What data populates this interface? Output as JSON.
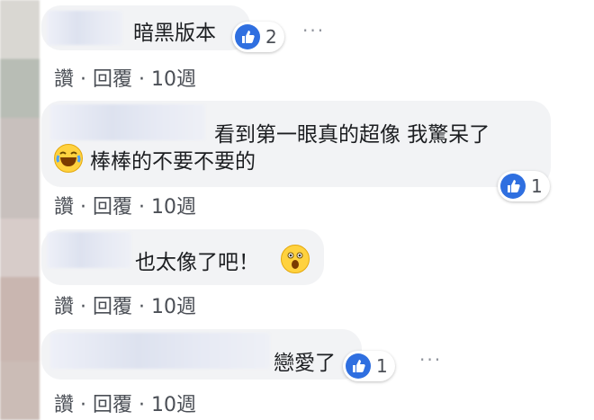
{
  "comments": [
    {
      "text": "暗黑版本",
      "likes": "2",
      "actions": {
        "like": "讚",
        "reply": "回覆",
        "time": "10週"
      }
    },
    {
      "text_line1": "看到第一眼真的超像 我驚呆了",
      "text_line2": "棒棒的不要不要的",
      "likes": "1",
      "actions": {
        "like": "讚",
        "reply": "回覆",
        "time": "10週"
      }
    },
    {
      "text": "也太像了吧！",
      "actions": {
        "like": "讚",
        "reply": "回覆",
        "time": "10週"
      }
    },
    {
      "text": "戀愛了",
      "likes": "1",
      "actions": {
        "like": "讚",
        "reply": "回覆",
        "time": "10週"
      }
    }
  ],
  "separator": "·",
  "more": "···",
  "colors": {
    "like_blue": "#2f6fe0",
    "bubble": "#f2f3f5",
    "action_text": "#4b4f56"
  },
  "icons": [
    "thumbs-up-icon",
    "laughing-emoji-icon",
    "surprised-emoji-icon",
    "more-options-icon"
  ]
}
